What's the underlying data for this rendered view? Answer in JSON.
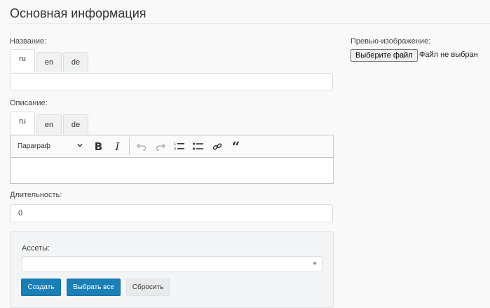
{
  "section": {
    "title": "Основная информация"
  },
  "name_field": {
    "label": "Название:",
    "tabs": [
      {
        "label": "ru"
      },
      {
        "label": "en"
      },
      {
        "label": "de"
      }
    ],
    "value": ""
  },
  "description_field": {
    "label": "Описание:",
    "tabs": [
      {
        "label": "ru"
      },
      {
        "label": "en"
      },
      {
        "label": "de"
      }
    ],
    "toolbar": {
      "heading": "Параграф",
      "icons": [
        "bold-icon",
        "italic-icon",
        "undo-icon",
        "redo-icon",
        "numbered-list-icon",
        "bulleted-list-icon",
        "link-icon",
        "blockquote-icon"
      ]
    }
  },
  "duration_field": {
    "label": "Длительность:",
    "value": "0"
  },
  "preview": {
    "label": "Превью-изображение:",
    "choose_file": "Выберите файл",
    "status": "Файл не выбран"
  },
  "assets": {
    "label": "Ассеты:",
    "selected": "",
    "buttons": {
      "create": "Создать",
      "select_all": "Выбрать все",
      "reset": "Сбросить"
    }
  },
  "colors": {
    "primary": "#1a7fb6",
    "background": "#f8f9f8"
  }
}
